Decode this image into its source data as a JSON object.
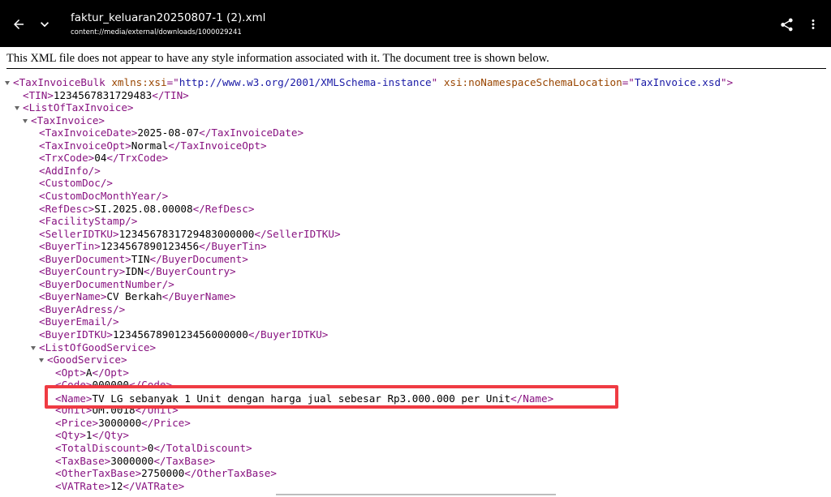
{
  "appbar": {
    "title": "faktur_keluaran20250807-1 (2).xml",
    "subtitle": "content://media/external/downloads/1000029241"
  },
  "notice": "This XML file does not appear to have any style information associated with it. The document tree is shown below.",
  "tree": [
    {
      "toggle": true,
      "parts": [
        [
          "tag",
          "<TaxInvoiceBulk"
        ],
        [
          "txt",
          " "
        ],
        [
          "attr-name",
          "xmlns:xsi"
        ],
        [
          "tag",
          "=\""
        ],
        [
          "attr-value",
          "http://www.w3.org/2001/XMLSchema-instance"
        ],
        [
          "tag",
          "\""
        ],
        [
          "txt",
          " "
        ],
        [
          "attr-name",
          "xsi:noNamespaceSchemaLocation"
        ],
        [
          "tag",
          "=\""
        ],
        [
          "attr-value",
          "TaxInvoice.xsd"
        ],
        [
          "tag",
          "\">"
        ]
      ]
    },
    {
      "toggle": false,
      "parts": [
        [
          "tag",
          "<TIN>"
        ],
        [
          "txt",
          "1234567831729483"
        ],
        [
          "tag",
          "</TIN>"
        ]
      ]
    },
    {
      "toggle": true,
      "parts": [
        [
          "tag",
          "<ListOfTaxInvoice>"
        ]
      ]
    },
    {
      "toggle": true,
      "parts": [
        [
          "tag",
          "<TaxInvoice>"
        ]
      ]
    },
    {
      "toggle": false,
      "parts": [
        [
          "tag",
          "<TaxInvoiceDate>"
        ],
        [
          "txt",
          "2025-08-07"
        ],
        [
          "tag",
          "</TaxInvoiceDate>"
        ]
      ]
    },
    {
      "toggle": false,
      "parts": [
        [
          "tag",
          "<TaxInvoiceOpt>"
        ],
        [
          "txt",
          "Normal"
        ],
        [
          "tag",
          "</TaxInvoiceOpt>"
        ]
      ]
    },
    {
      "toggle": false,
      "parts": [
        [
          "tag",
          "<TrxCode>"
        ],
        [
          "txt",
          "04"
        ],
        [
          "tag",
          "</TrxCode>"
        ]
      ]
    },
    {
      "toggle": false,
      "parts": [
        [
          "tag",
          "<AddInfo/>"
        ]
      ]
    },
    {
      "toggle": false,
      "parts": [
        [
          "tag",
          "<CustomDoc/>"
        ]
      ]
    },
    {
      "toggle": false,
      "parts": [
        [
          "tag",
          "<CustomDocMonthYear/>"
        ]
      ]
    },
    {
      "toggle": false,
      "parts": [
        [
          "tag",
          "<RefDesc>"
        ],
        [
          "txt",
          "SI.2025.08.00008"
        ],
        [
          "tag",
          "</RefDesc>"
        ]
      ]
    },
    {
      "toggle": false,
      "parts": [
        [
          "tag",
          "<FacilityStamp/>"
        ]
      ]
    },
    {
      "toggle": false,
      "parts": [
        [
          "tag",
          "<SellerIDTKU>"
        ],
        [
          "txt",
          "1234567831729483000000"
        ],
        [
          "tag",
          "</SellerIDTKU>"
        ]
      ]
    },
    {
      "toggle": false,
      "parts": [
        [
          "tag",
          "<BuyerTin>"
        ],
        [
          "txt",
          "1234567890123456"
        ],
        [
          "tag",
          "</BuyerTin>"
        ]
      ]
    },
    {
      "toggle": false,
      "parts": [
        [
          "tag",
          "<BuyerDocument>"
        ],
        [
          "txt",
          "TIN"
        ],
        [
          "tag",
          "</BuyerDocument>"
        ]
      ]
    },
    {
      "toggle": false,
      "parts": [
        [
          "tag",
          "<BuyerCountry>"
        ],
        [
          "txt",
          "IDN"
        ],
        [
          "tag",
          "</BuyerCountry>"
        ]
      ]
    },
    {
      "toggle": false,
      "parts": [
        [
          "tag",
          "<BuyerDocumentNumber/>"
        ]
      ]
    },
    {
      "toggle": false,
      "parts": [
        [
          "tag",
          "<BuyerName>"
        ],
        [
          "txt",
          "CV Berkah"
        ],
        [
          "tag",
          "</BuyerName>"
        ]
      ]
    },
    {
      "toggle": false,
      "parts": [
        [
          "tag",
          "<BuyerAdress/>"
        ]
      ]
    },
    {
      "toggle": false,
      "parts": [
        [
          "tag",
          "<BuyerEmail/>"
        ]
      ]
    },
    {
      "toggle": false,
      "parts": [
        [
          "tag",
          "<BuyerIDTKU>"
        ],
        [
          "txt",
          "1234567890123456000000"
        ],
        [
          "tag",
          "</BuyerIDTKU>"
        ]
      ]
    },
    {
      "toggle": true,
      "parts": [
        [
          "tag",
          "<ListOfGoodService>"
        ]
      ]
    },
    {
      "toggle": true,
      "parts": [
        [
          "tag",
          "<GoodService>"
        ]
      ]
    },
    {
      "toggle": false,
      "parts": [
        [
          "tag",
          "<Opt>"
        ],
        [
          "txt",
          "A"
        ],
        [
          "tag",
          "</Opt>"
        ]
      ]
    },
    {
      "toggle": false,
      "parts": [
        [
          "tag",
          "<Code>"
        ],
        [
          "txt",
          "000000"
        ],
        [
          "tag",
          "</Code>"
        ]
      ]
    },
    {
      "toggle": false,
      "parts": [
        [
          "tag",
          "<Name>"
        ],
        [
          "txt",
          "TV LG sebanyak 1 Unit dengan harga jual sebesar Rp3.000.000 per Unit"
        ],
        [
          "tag",
          "</Name>"
        ]
      ]
    },
    {
      "toggle": false,
      "parts": [
        [
          "tag",
          "<Unit>"
        ],
        [
          "txt",
          "UM.0018"
        ],
        [
          "tag",
          "</Unit>"
        ]
      ]
    },
    {
      "toggle": false,
      "parts": [
        [
          "tag",
          "<Price>"
        ],
        [
          "txt",
          "3000000"
        ],
        [
          "tag",
          "</Price>"
        ]
      ]
    },
    {
      "toggle": false,
      "parts": [
        [
          "tag",
          "<Qty>"
        ],
        [
          "txt",
          "1"
        ],
        [
          "tag",
          "</Qty>"
        ]
      ]
    },
    {
      "toggle": false,
      "parts": [
        [
          "tag",
          "<TotalDiscount>"
        ],
        [
          "txt",
          "0"
        ],
        [
          "tag",
          "</TotalDiscount>"
        ]
      ]
    },
    {
      "toggle": false,
      "parts": [
        [
          "tag",
          "<TaxBase>"
        ],
        [
          "txt",
          "3000000"
        ],
        [
          "tag",
          "</TaxBase>"
        ]
      ]
    },
    {
      "toggle": false,
      "parts": [
        [
          "tag",
          "<OtherTaxBase>"
        ],
        [
          "txt",
          "2750000"
        ],
        [
          "tag",
          "</OtherTaxBase>"
        ]
      ]
    },
    {
      "toggle": false,
      "parts": [
        [
          "tag",
          "<VATRate>"
        ],
        [
          "txt",
          "12"
        ],
        [
          "tag",
          "</VATRate>"
        ]
      ]
    }
  ],
  "icons": {
    "back": "back-arrow-icon",
    "expand": "chevron-down-icon",
    "share": "share-icon",
    "menu": "more-vert-icon"
  },
  "colors": {
    "highlight": "#ef3b43"
  }
}
